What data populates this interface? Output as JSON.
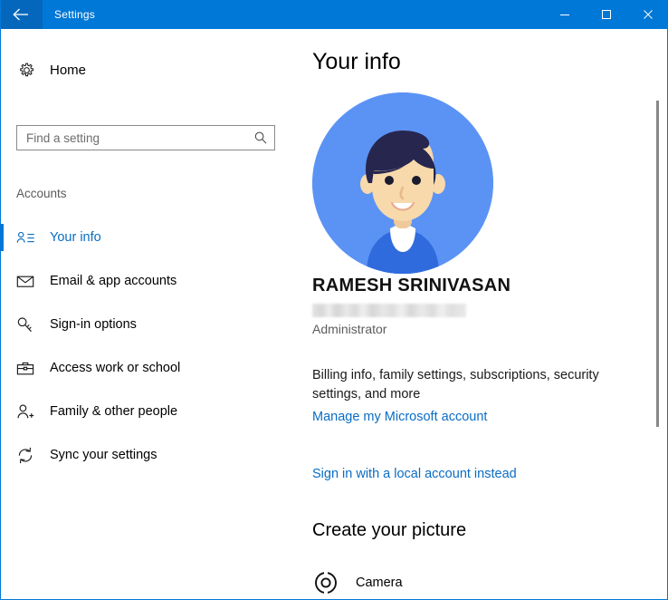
{
  "window": {
    "title": "Settings",
    "back_icon": "back-arrow-icon",
    "minimize_label": "Minimize",
    "maximize_label": "Maximize",
    "close_label": "Close",
    "accent_color": "#0078d7",
    "titlebar_color": "#0078d7",
    "back_button_color": "#0567bb"
  },
  "sidebar": {
    "home": {
      "label": "Home",
      "icon": "gear-icon"
    },
    "search": {
      "placeholder": "Find a setting",
      "value": "",
      "icon": "search-icon"
    },
    "group_header": "Accounts",
    "items": [
      {
        "label": "Your info",
        "icon": "user-info-icon",
        "selected": true
      },
      {
        "label": "Email & app accounts",
        "icon": "envelope-icon",
        "selected": false
      },
      {
        "label": "Sign-in options",
        "icon": "key-icon",
        "selected": false
      },
      {
        "label": "Access work or school",
        "icon": "briefcase-icon",
        "selected": false
      },
      {
        "label": "Family & other people",
        "icon": "add-person-icon",
        "selected": false
      },
      {
        "label": "Sync your settings",
        "icon": "sync-icon",
        "selected": false
      }
    ]
  },
  "content": {
    "page_title": "Your info",
    "avatar": {
      "name": "user-avatar-illustration",
      "background_color": "#5b93f5",
      "hair_color": "#26264f",
      "skin_color": "#f7d9ab",
      "shirt_color": "#2f6bdd"
    },
    "user_name": "RAMESH SRINIVASAN",
    "email_redacted": true,
    "user_role": "Administrator",
    "description": "Billing info, family settings, subscriptions, security settings, and more",
    "manage_account_link": "Manage my Microsoft account",
    "local_account_link": "Sign in with a local account instead",
    "section_title": "Create your picture",
    "camera": {
      "label": "Camera",
      "icon": "camera-circle-icon"
    }
  }
}
